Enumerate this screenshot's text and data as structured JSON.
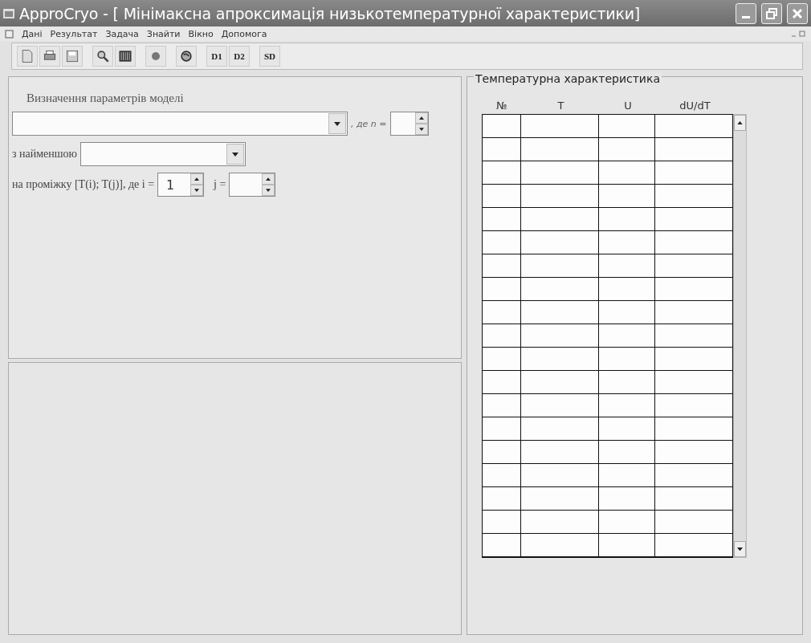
{
  "window": {
    "title": "ApproCryo - [ Мінімаксна апроксимація низькотемпературної характеристики]"
  },
  "menu": [
    "Дані",
    "Результат",
    "Задача",
    "Знайти",
    "Вікно",
    "Допомога"
  ],
  "toolbar": {
    "text_buttons": [
      "D1",
      "D2",
      "SD"
    ]
  },
  "model_form": {
    "heading": "Визначення параметрів моделі",
    "n_label": ", де n =",
    "min_label": "з найменшою",
    "interval_label": "на проміжку [T(i); T(j)],  де i =",
    "i_value": "1",
    "j_label": "j ="
  },
  "table": {
    "title": "Температурна характеристика",
    "columns": [
      "№",
      "T",
      "U",
      "dU/dT"
    ]
  }
}
